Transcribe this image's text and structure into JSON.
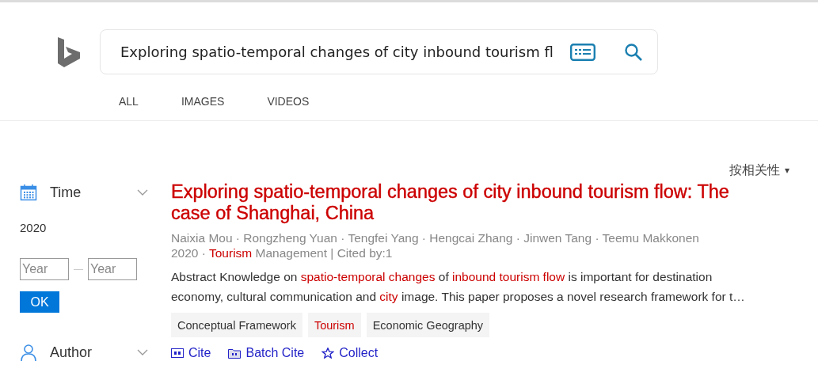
{
  "search": {
    "value": "Exploring spatio-temporal changes of city inbound tourism fl"
  },
  "tabs": [
    {
      "label": "ALL"
    },
    {
      "label": "IMAGES"
    },
    {
      "label": "VIDEOS"
    }
  ],
  "sort": {
    "label": "按相关性",
    "caret": "▾"
  },
  "filters": [
    {
      "kind": "time",
      "label": "Time",
      "value": "2020",
      "from_placeholder": "Year",
      "to_placeholder": "Year",
      "button": "OK"
    },
    {
      "kind": "author",
      "label": "Author"
    }
  ],
  "result": {
    "title": "Exploring spatio-temporal changes of city inbound tourism flow: The case of Shanghai, China",
    "authors": "Naixia Mou · Rongzheng Yuan · Tengfei Yang · Hengcai Zhang · Jinwen Tang · Teemu Makkonen",
    "venue": [
      {
        "text": "2020 · ",
        "highlight": false
      },
      {
        "text": "Tourism",
        "highlight": true
      },
      {
        "text": " Management  |  Cited by:1",
        "highlight": false
      }
    ],
    "abstract": [
      {
        "text": "Abstract Knowledge on ",
        "highlight": false
      },
      {
        "text": "spatio-temporal changes",
        "highlight": true
      },
      {
        "text": " of ",
        "highlight": false
      },
      {
        "text": "inbound tourism flow",
        "highlight": true
      },
      {
        "text": " is important for destination economy, cultural communication and ",
        "highlight": false
      },
      {
        "text": "city",
        "highlight": true
      },
      {
        "text": " image. This paper proposes a novel research framework for t…",
        "highlight": false
      }
    ],
    "tags": [
      {
        "label": "Conceptual Framework",
        "highlight": false
      },
      {
        "label": "Tourism",
        "highlight": true
      },
      {
        "label": "Economic Geography",
        "highlight": false
      }
    ],
    "actions": [
      {
        "kind": "cite",
        "label": "Cite"
      },
      {
        "kind": "batch",
        "label": "Batch Cite"
      },
      {
        "kind": "collect",
        "label": "Collect"
      }
    ]
  }
}
